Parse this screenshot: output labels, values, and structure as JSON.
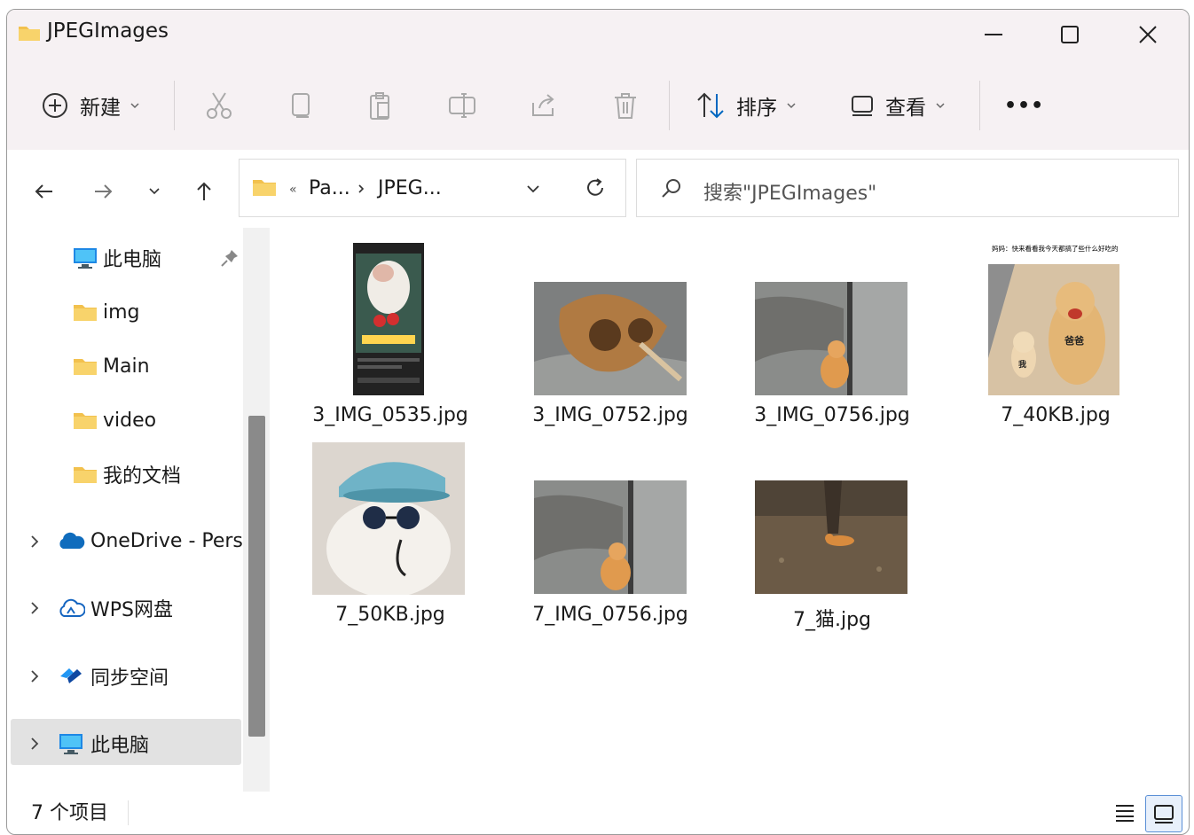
{
  "window": {
    "title": "JPEGImages"
  },
  "toolbar": {
    "new_label": "新建",
    "sort_label": "排序",
    "view_label": "查看",
    "more_label": "•••"
  },
  "address": {
    "crumb1": "Pa...",
    "crumb2": "JPEG...",
    "overflow": "«"
  },
  "search": {
    "placeholder": "搜索\"JPEGImages\""
  },
  "sidebar": {
    "quick": [
      {
        "label": "此电脑"
      },
      {
        "label": "img"
      },
      {
        "label": "Main"
      },
      {
        "label": "video"
      },
      {
        "label": "我的文档"
      }
    ],
    "roots": [
      {
        "label": "OneDrive - Pers"
      },
      {
        "label": "WPS网盘"
      },
      {
        "label": "同步空间"
      },
      {
        "label": "此电脑"
      }
    ]
  },
  "files": [
    {
      "name": "3_IMG_0535.jpg"
    },
    {
      "name": "3_IMG_0752.jpg"
    },
    {
      "name": "3_IMG_0756.jpg"
    },
    {
      "name": "7_40KB.jpg",
      "caption_top": "妈妈：快来看看我今天都搞了些什么好吃的",
      "label_big": "爸爸",
      "label_small": "我"
    },
    {
      "name": "7_50KB.jpg"
    },
    {
      "name": "7_IMG_0756.jpg"
    },
    {
      "name": "7_猫.jpg"
    }
  ],
  "status": {
    "count_text": "7 个项目"
  },
  "colors": {
    "folder": "#f2c14e",
    "accent": "#0067c0",
    "onedrive": "#0f6cbd"
  }
}
